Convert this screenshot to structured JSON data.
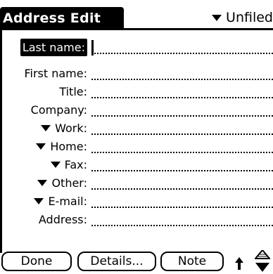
{
  "window": {
    "title": "Address Edit"
  },
  "category": {
    "label": "Unfiled",
    "icon": "dropdown-triangle-icon"
  },
  "fields": [
    {
      "label": "Last name:",
      "dropdown": false,
      "selected": true
    },
    {
      "label": "First name:",
      "dropdown": false
    },
    {
      "label": "Title:",
      "dropdown": false
    },
    {
      "label": "Company:",
      "dropdown": false
    },
    {
      "label": "Work:",
      "dropdown": true
    },
    {
      "label": "Home:",
      "dropdown": true
    },
    {
      "label": "Fax:",
      "dropdown": true
    },
    {
      "label": "Other:",
      "dropdown": true
    },
    {
      "label": "E-mail:",
      "dropdown": true
    },
    {
      "label": "Address:",
      "dropdown": false
    }
  ],
  "buttons": {
    "done": "Done",
    "details": "Details...",
    "note": "Note"
  }
}
